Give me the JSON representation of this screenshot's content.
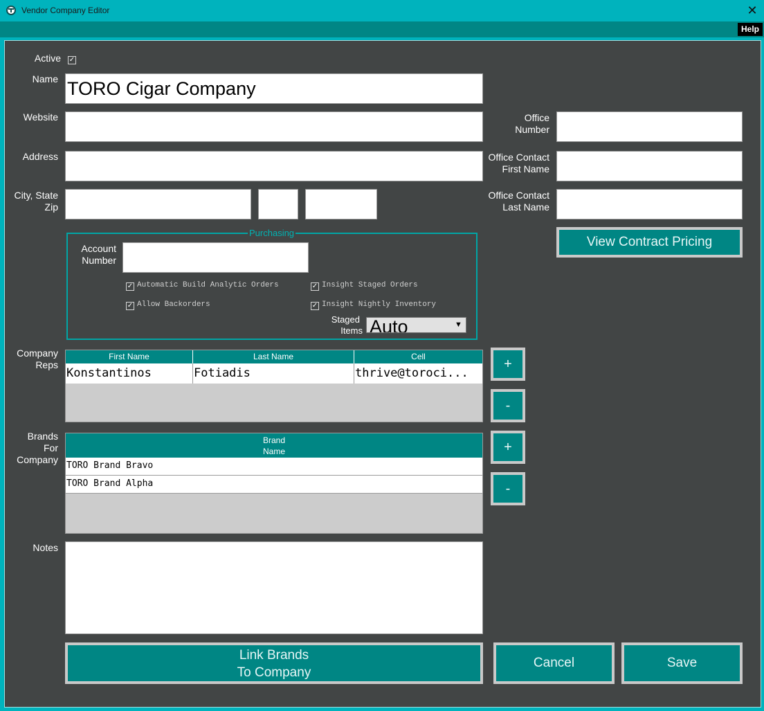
{
  "window": {
    "title": "Vendor Company Editor",
    "close_glyph": "✕"
  },
  "menu": {
    "help_label": "Help"
  },
  "form": {
    "active_label": "Active",
    "active_checked": true,
    "name_label": "Name",
    "name_value": "TORO Cigar Company",
    "website_label": "Website",
    "website_value": "",
    "address_label": "Address",
    "address_value": "",
    "city_state_label": "City, State",
    "zip_label": "Zip",
    "city_value": "",
    "state_value": "",
    "zip_value": "",
    "office_number_label_1": "Office",
    "office_number_label_2": "Number",
    "office_number_value": "",
    "office_first_label_1": "Office Contact",
    "office_first_label_2": "First Name",
    "office_first_value": "",
    "office_last_label_1": "Office Contact",
    "office_last_label_2": "Last Name",
    "office_last_value": "",
    "view_contract_pricing_label": "View Contract Pricing"
  },
  "purchasing": {
    "title": "Purchasing",
    "account_label_1": "Account",
    "account_label_2": "Number",
    "account_value": "",
    "options": {
      "auto_build": {
        "label": "Automatic Build Analytic Orders",
        "checked": true
      },
      "allow_backorders": {
        "label": "Allow Backorders",
        "checked": true
      },
      "insight_staged": {
        "label": "Insight Staged Orders",
        "checked": true
      },
      "insight_nightly": {
        "label": "Insight Nightly Inventory",
        "checked": true
      }
    },
    "staged_label_1": "Staged",
    "staged_label_2": "Items",
    "staged_value": "Auto"
  },
  "reps": {
    "label_1": "Company",
    "label_2": "Reps",
    "columns": [
      "First Name",
      "Last Name",
      "Cell"
    ],
    "rows": [
      [
        "Konstantinos",
        "Fotiadis",
        "thrive@toroci..."
      ]
    ],
    "add_label": "+",
    "remove_label": "-"
  },
  "brands": {
    "label_1": "Brands",
    "label_2": "For",
    "label_3": "Company",
    "column_1": "Brand",
    "column_2": "Name",
    "rows": [
      "TORO Brand Bravo",
      "TORO Brand Alpha"
    ],
    "add_label": "+",
    "remove_label": "-"
  },
  "notes": {
    "label": "Notes",
    "value": ""
  },
  "buttons": {
    "link_brands_1": "Link Brands",
    "link_brands_2": "To Company",
    "cancel": "Cancel",
    "save": "Save"
  },
  "colors": {
    "titlebar": "#00b3bd",
    "menustrip": "#008685",
    "panel": "#424545",
    "accent": "#008684",
    "button_border": "#c9c9c9",
    "grid_empty": "#cccccc"
  },
  "icons": {
    "app": "app-logo-icon",
    "close": "close-icon",
    "check": "checkmark-icon",
    "dropdown": "dropdown-arrow-icon"
  }
}
